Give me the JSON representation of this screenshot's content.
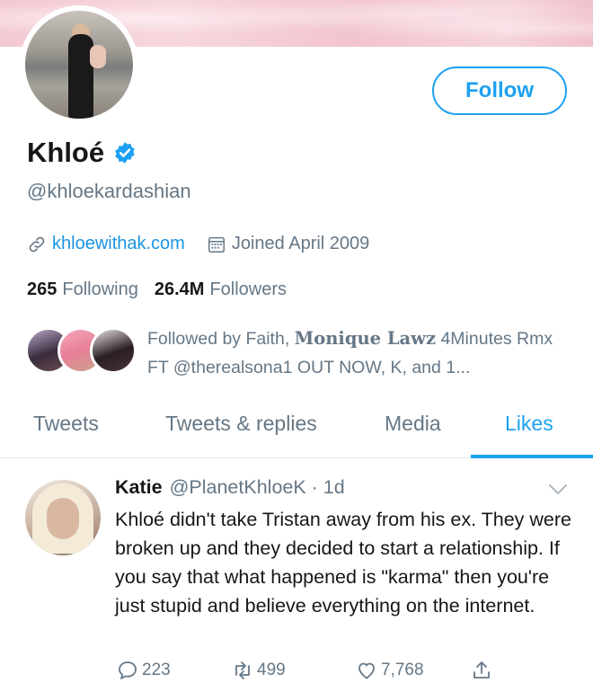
{
  "profile": {
    "name": "Khloé",
    "handle": "@khloekardashian",
    "website": "khloewithak.com",
    "joined": "Joined April 2009",
    "following_count": "265",
    "following_label": "Following",
    "followers_count": "26.4M",
    "followers_label": "Followers",
    "follow_button": "Follow"
  },
  "followed_by": {
    "prefix": "Followed by Faith, ",
    "gothic_name": "Monique Lawz",
    "rest": " 4Minutes Rmx FT @therealsona1 OUT NOW, K, and 1..."
  },
  "tabs": [
    {
      "label": "Tweets"
    },
    {
      "label": "Tweets & replies"
    },
    {
      "label": "Media"
    },
    {
      "label": "Likes"
    }
  ],
  "tweet": {
    "author_name": "Katie",
    "author_handle": "@PlanetKhloeK · 1d",
    "text": "Khloé didn't take Tristan away from his ex. They were broken up and they decided to start a relationship. If you say that what happened is \"karma\" then you're just stupid and believe everything on the internet.",
    "replies": "223",
    "retweets": "499",
    "likes": "7,768"
  },
  "colors": {
    "accent": "#1da1f2",
    "link": "#1b95e0",
    "secondary_text": "#657786",
    "primary_text": "#14171a"
  },
  "icons": [
    "verified-badge-icon",
    "link-icon",
    "calendar-icon",
    "chevron-down-icon",
    "reply-icon",
    "retweet-icon",
    "like-icon",
    "share-icon"
  ]
}
